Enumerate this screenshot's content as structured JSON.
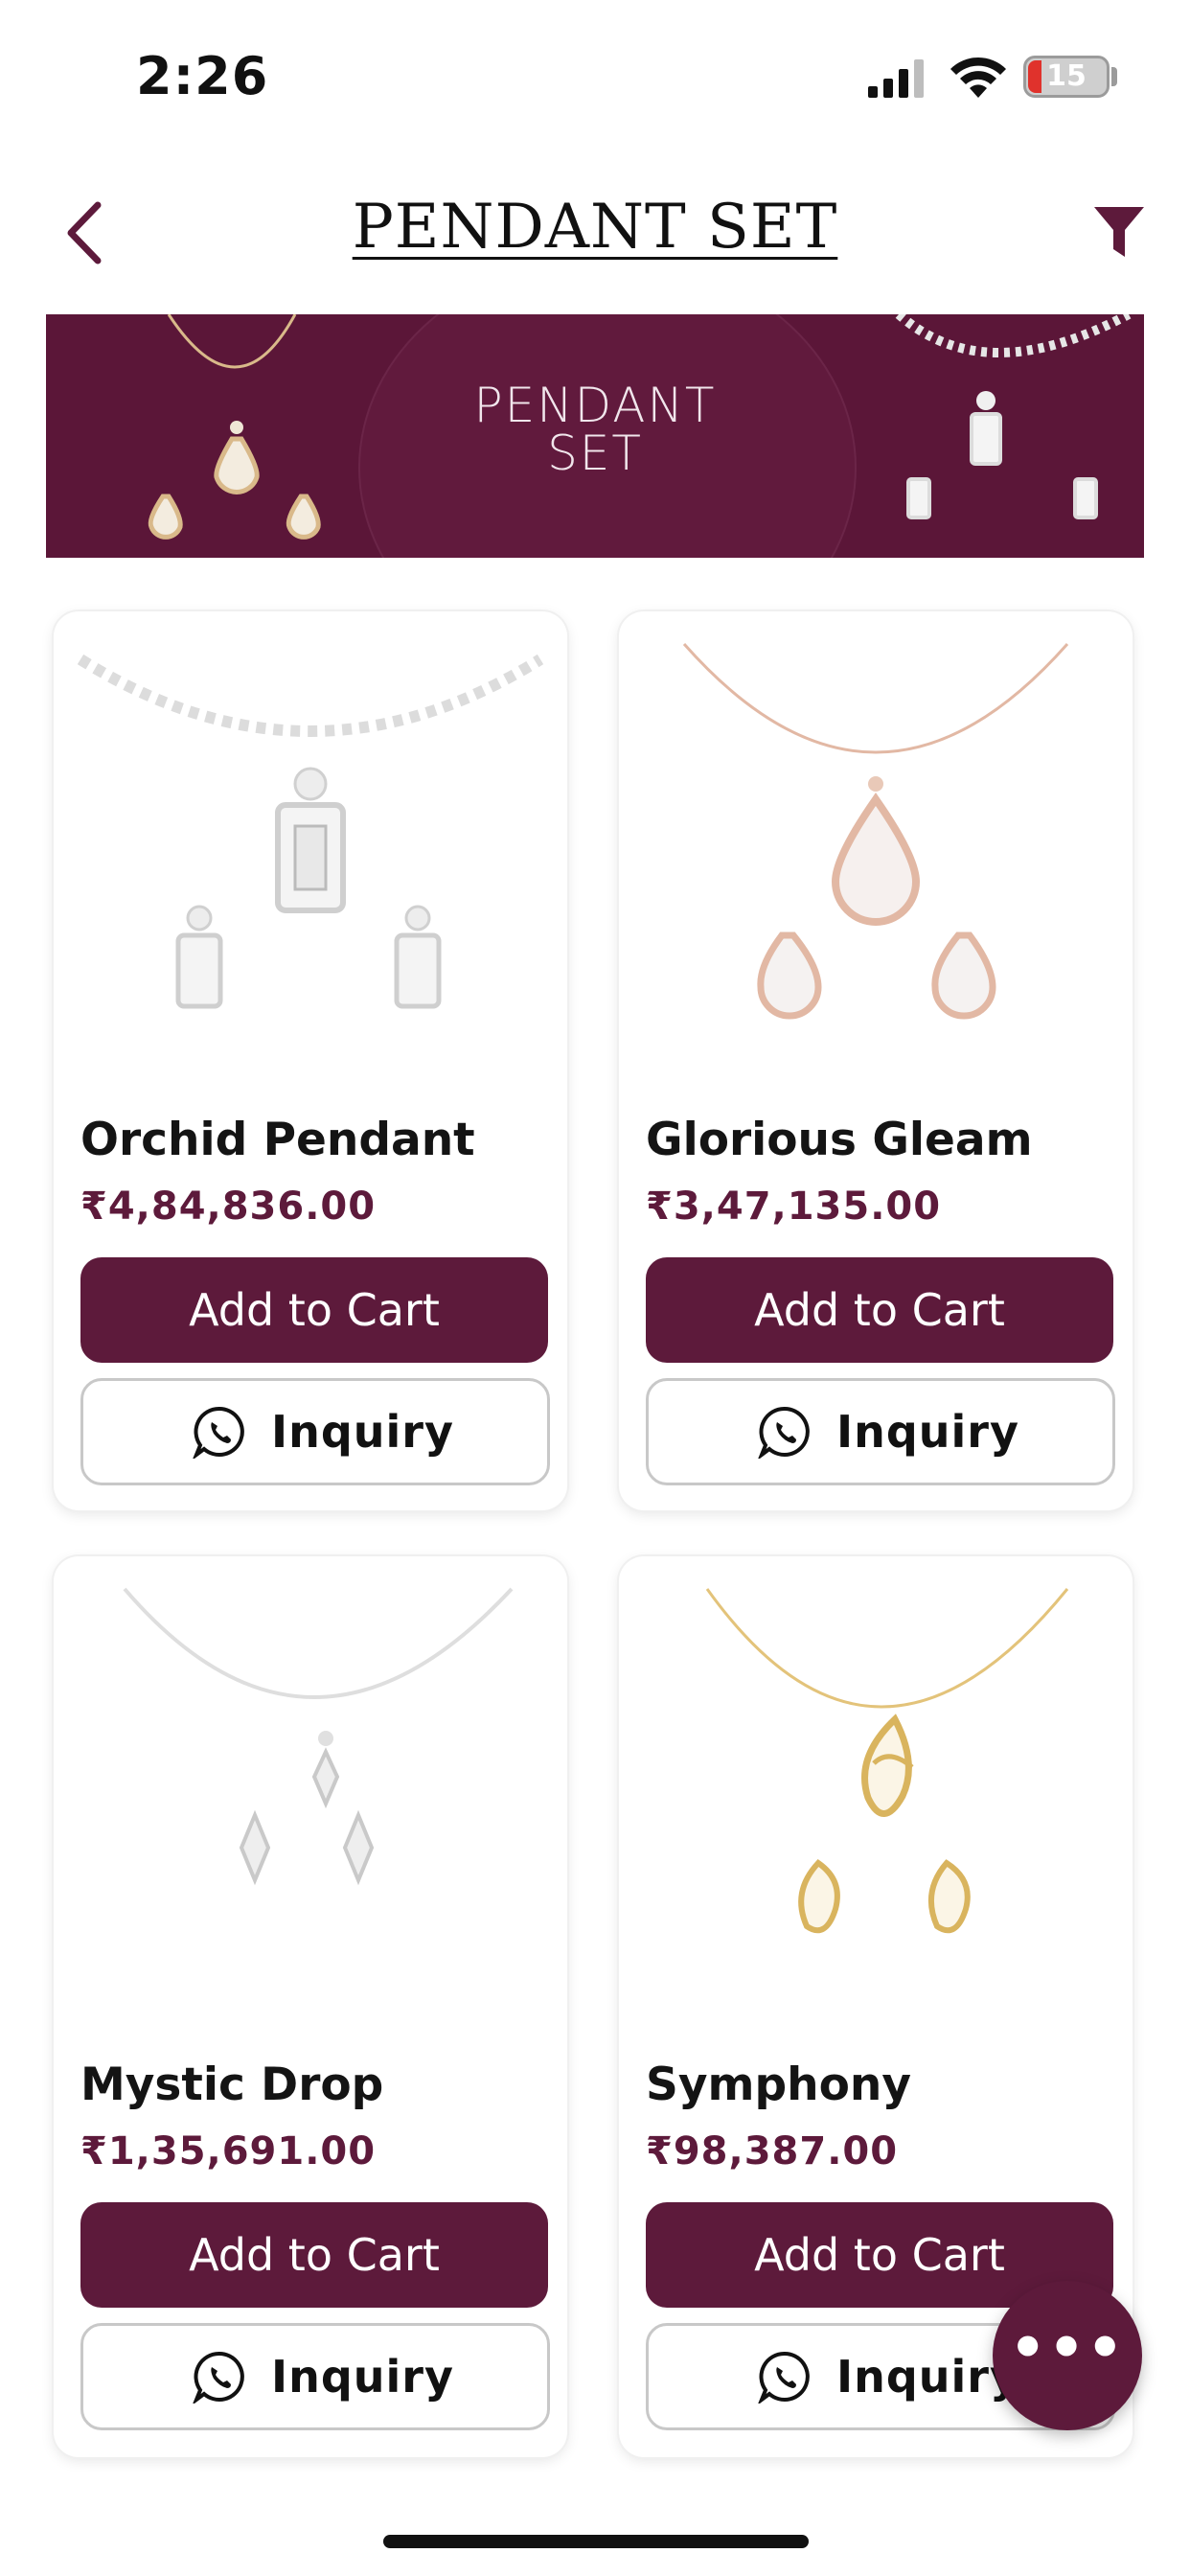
{
  "status": {
    "time": "2:26",
    "battery": "15"
  },
  "header": {
    "title": "PENDANT SET"
  },
  "banner": {
    "line1": "PENDANT",
    "line2": "SET"
  },
  "products": [
    {
      "name": "Orchid Pendant",
      "price": "₹4,84,836.00",
      "cart_label": "Add to Cart",
      "inquiry_label": "Inquiry"
    },
    {
      "name": "Glorious Gleam",
      "price": "₹3,47,135.00",
      "cart_label": "Add to Cart",
      "inquiry_label": "Inquiry"
    },
    {
      "name": "Mystic Drop",
      "price": "₹1,35,691.00",
      "cart_label": "Add to Cart",
      "inquiry_label": "Inquiry"
    },
    {
      "name": "Symphony",
      "price": "₹98,387.00",
      "cart_label": "Add to Cart",
      "inquiry_label": "Inquiry"
    }
  ],
  "fab": {
    "icon": "more-horizontal-icon",
    "label": "•••"
  },
  "colors": {
    "brand": "#5d1a3b",
    "banner": "#5b1638",
    "price": "#5d1a3b"
  }
}
